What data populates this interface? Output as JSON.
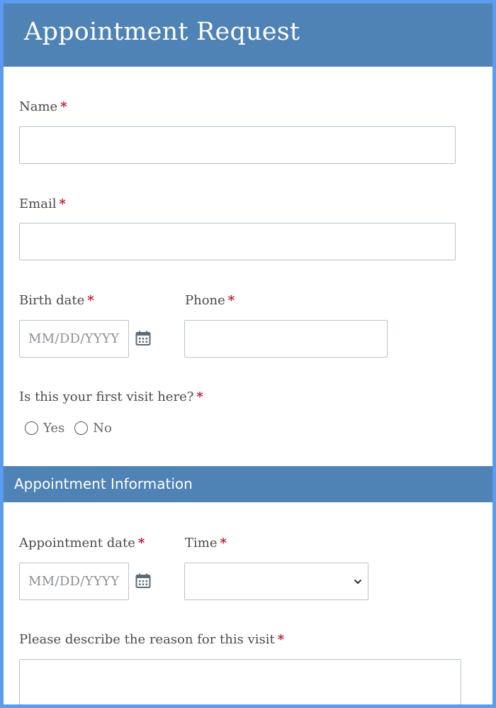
{
  "form": {
    "title": "Appointment Request",
    "required_mark": "*",
    "name": {
      "label": "Name",
      "value": ""
    },
    "email": {
      "label": "Email",
      "value": ""
    },
    "birth_date": {
      "label": "Birth date",
      "placeholder": "MM/DD/YYYY"
    },
    "phone": {
      "label": "Phone",
      "value": ""
    },
    "first_visit": {
      "label": "Is this your first visit here?",
      "options": [
        "Yes",
        "No"
      ]
    },
    "section": {
      "title": "Appointment Information"
    },
    "appointment_date": {
      "label": "Appointment date",
      "placeholder": "MM/DD/YYYY"
    },
    "time": {
      "label": "Time",
      "selected": ""
    },
    "reason": {
      "label": "Please describe the reason for this visit",
      "value": ""
    }
  },
  "icons": {
    "calendar": "calendar-icon",
    "chevron": "chevron-down-icon",
    "radio": "radio-button"
  },
  "colors": {
    "header_bg": "#4f83b5",
    "frame_border": "#5b9bf0",
    "required": "#c8102e"
  }
}
